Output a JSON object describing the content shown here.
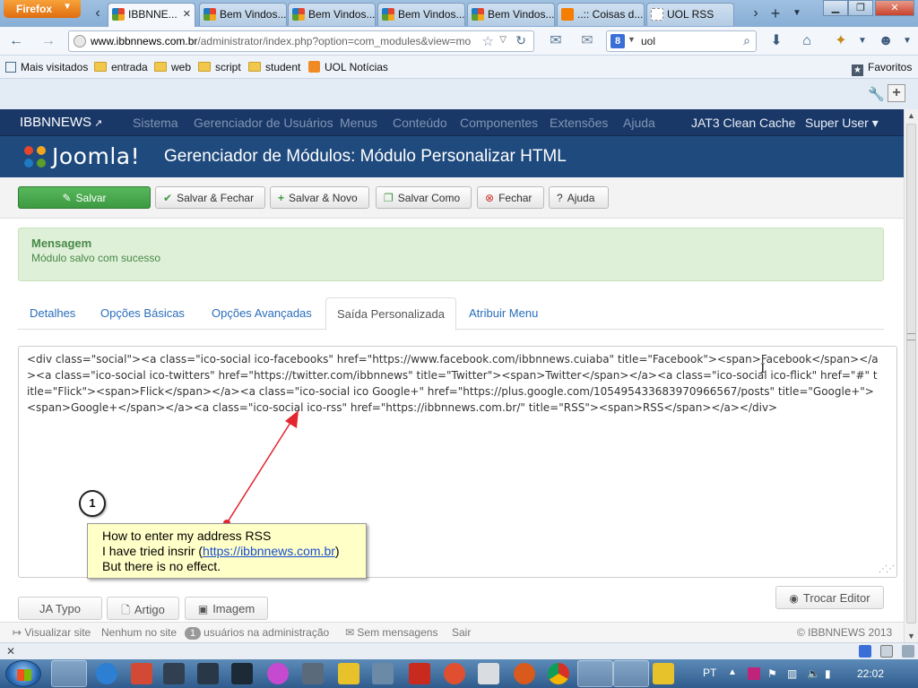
{
  "browser": {
    "menu_button": "Firefox",
    "tabs": [
      {
        "title": "IBBNNE...",
        "icon": "joomla-icon",
        "active": true
      },
      {
        "title": "Bem Vindos...",
        "icon": "joomla-icon"
      },
      {
        "title": "Bem Vindos...",
        "icon": "joomla-icon"
      },
      {
        "title": "Bem Vindos...",
        "icon": "joomla-icon"
      },
      {
        "title": "Bem Vindos...",
        "icon": "joomla-icon"
      },
      {
        "title": "..:: Coisas d...",
        "icon": "blogger-icon"
      },
      {
        "title": "UOL RSS",
        "icon": "blank-page-icon"
      }
    ],
    "url_host": "www.ibbnnews.com.br",
    "url_path": "/administrator/index.php?option=com_modules&view=mo",
    "search_value": "uol",
    "bookmarks": [
      "Mais visitados",
      "entrada",
      "web",
      "script",
      "student",
      "UOL Notícias"
    ],
    "bookmarks_right": "Favoritos"
  },
  "joomla": {
    "site_name": "IBBNNEWS",
    "menu": [
      "Sistema",
      "Gerenciador de Usuários",
      "Menus",
      "Conteúdo",
      "Componentes",
      "Extensões",
      "Ajuda"
    ],
    "right_menu": [
      "JAT3 Clean Cache",
      "Super User ▾"
    ],
    "logo_text": "Joomla!",
    "page_title": "Gerenciador de Módulos: Módulo Personalizar HTML",
    "toolbar": {
      "save": "Salvar",
      "save_close": "Salvar & Fechar",
      "save_new": "Salvar & Novo",
      "save_copy": "Salvar Como",
      "close": "Fechar",
      "help": "Ajuda"
    },
    "message": {
      "title": "Mensagem",
      "text": "Módulo salvo com sucesso"
    },
    "tabs": [
      "Detalhes",
      "Opções Básicas",
      "Opções Avançadas",
      "Saída Personalizada",
      "Atribuir Menu"
    ],
    "active_tab": "Saída Personalizada",
    "code": "<div class=\"social\"><a class=\"ico-social ico-facebooks\" href=\"https://www.facebook.com/ibbnnews.cuiaba\" title=\"Facebook\"><span>Facebook</span></a><a class=\"ico-social ico-twitters\" href=\"https://twitter.com/ibbnnews\" title=\"Twitter\"><span>Twitter</span></a><a class=\"ico-social ico-flick\" href=\"#\" title=\"Flick\"><span>Flick</span></a><a class=\"ico-social ico Google+\" href=\"https://plus.google.com/105495433683970966567/posts\" title=\"Google+\"><span>Google+</span></a><a class=\"ico-social ico-rss\" href=\"https://ibbnnews.com.br/\" title=\"RSS\"><span>RSS</span></a></div>",
    "editor_buttons": [
      "JA Typo",
      "Artigo",
      "Imagem"
    ],
    "toggle_editor": "Trocar Editor",
    "status": {
      "view_site": "Visualizar site",
      "visitors": "Nenhum no site",
      "admin_count": "1",
      "admin_label": "usuários na administração",
      "messages": "Sem mensagens",
      "logout": "Sair",
      "copyright": "© IBBNNEWS 2013"
    }
  },
  "annotation": {
    "number": "1",
    "line1": "How to enter my address RSS",
    "line2_prefix": "I have tried insrir (",
    "line2_link": "https://ibbnnews.com.br",
    "line2_suffix": ")",
    "line3": "But there is no effect."
  },
  "taskbar": {
    "language": "PT",
    "clock": "22:02"
  }
}
